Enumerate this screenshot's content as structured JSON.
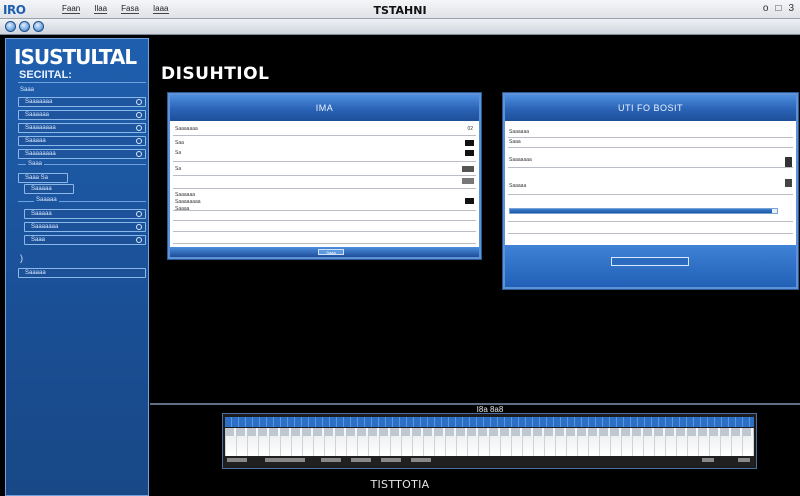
{
  "app": {
    "logo": "IRO",
    "window_title": "TSTAHNI"
  },
  "menu": [
    "Faan",
    "Ilaa",
    "Fasa",
    "Iaaa"
  ],
  "window_controls": [
    "o",
    "□",
    "3"
  ],
  "sidebar": {
    "title": "ISUSTULTAL",
    "subtitle": "SECIITAL:",
    "items": [
      {
        "label": "Saaa"
      },
      {
        "label": "Saaaaaaa"
      },
      {
        "label": "Saaaaaa"
      },
      {
        "label": "Saaaaaaaa"
      },
      {
        "label": "Saaaaa"
      },
      {
        "label": "Saaaaaaaa"
      },
      {
        "label": "Saaa"
      },
      {
        "label": "Saaa  Sa"
      },
      {
        "label": "Saaaaa"
      },
      {
        "label": "Saaaaa"
      },
      {
        "label": "Saaaaa"
      },
      {
        "label": "Saaaaaaa"
      },
      {
        "label": "Saaa"
      },
      {
        "label": "Saaaaa"
      }
    ]
  },
  "main": {
    "heading": "DISUHTIOL"
  },
  "panel1": {
    "title": "IMA",
    "rows": [
      {
        "label": "Saaaaaaa",
        "value": "02"
      },
      {
        "label": "Saa",
        "value": ""
      },
      {
        "label": "Sa",
        "value": ""
      },
      {
        "label": "Sa",
        "value": ""
      },
      {
        "label": "Saaaaaa",
        "value": ""
      },
      {
        "label": "Saaaaaaaa",
        "value": ""
      },
      {
        "label": "Saaaa",
        "value": ""
      }
    ],
    "footer_button": "Saaa"
  },
  "panel2": {
    "title": "UTI FO BOSIT",
    "rows": [
      {
        "label": "Saaaaaa",
        "value": ""
      },
      {
        "label": "Saaa",
        "value": ""
      },
      {
        "label": "Saaaaaaa",
        "value": ""
      },
      {
        "label": "Saaaaa",
        "value": ""
      }
    ],
    "progress": 0.98,
    "ok_button": ""
  },
  "timeline": {
    "caption": "I8a 8a8"
  },
  "status": {
    "text": "TISTTOTIA"
  },
  "colors": {
    "accent": "#2a63b5",
    "panel_border": "#5d93d6",
    "background": "#000000"
  }
}
